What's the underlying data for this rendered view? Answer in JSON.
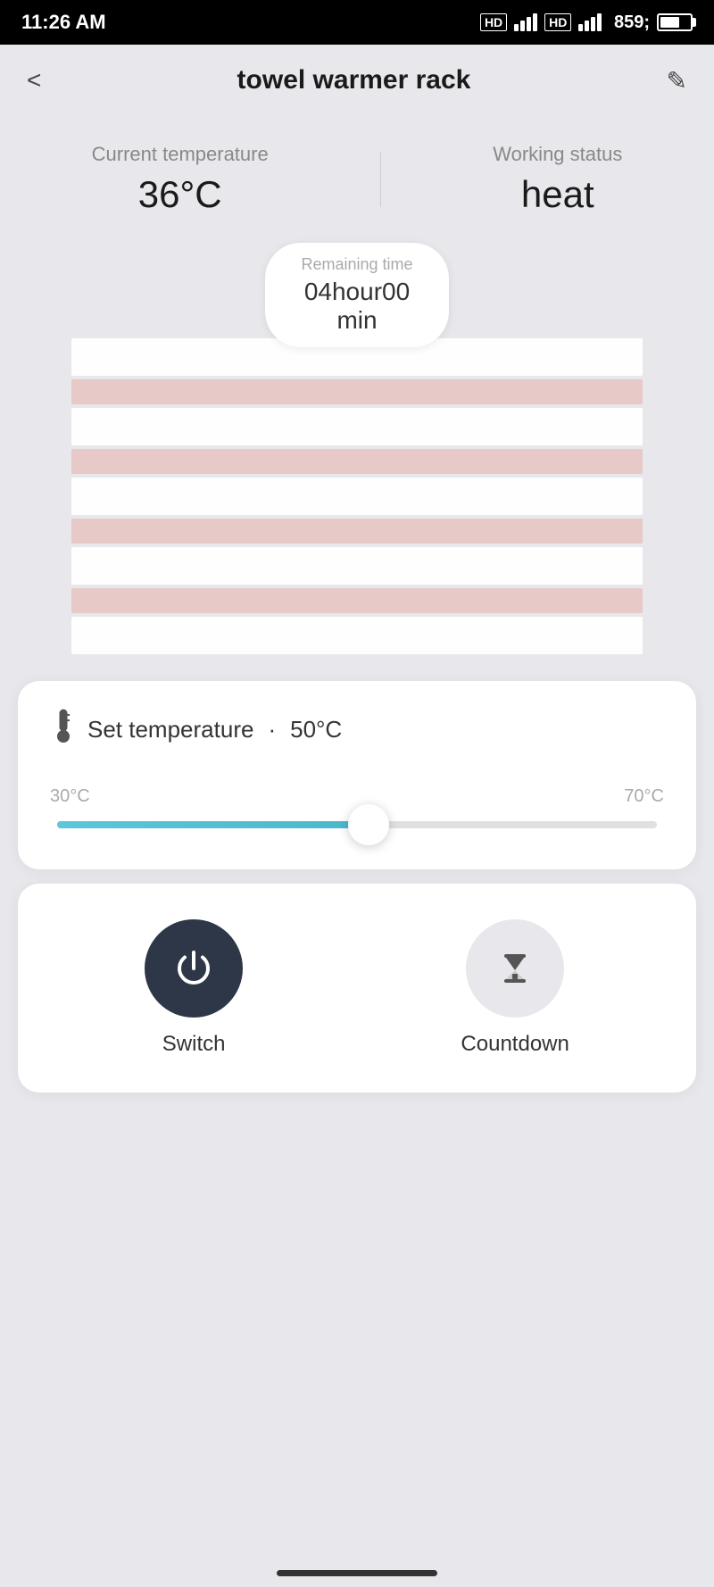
{
  "statusBar": {
    "time": "11:26 AM",
    "battery": 67
  },
  "header": {
    "title": "towel warmer rack",
    "backLabel": "<",
    "editLabel": "✎"
  },
  "stats": {
    "currentTempLabel": "Current temperature",
    "currentTempValue": "36°C",
    "workingStatusLabel": "Working status",
    "workingStatusValue": "heat"
  },
  "remaining": {
    "label": "Remaining time",
    "value": "04hour00",
    "unit": "min"
  },
  "tempCard": {
    "icon": "🌡",
    "title": "Set temperature",
    "dot": "·",
    "value": "50°C",
    "minLabel": "30°C",
    "maxLabel": "70°C",
    "sliderPercent": 52
  },
  "controls": {
    "switchLabel": "Switch",
    "countdownLabel": "Countdown"
  }
}
